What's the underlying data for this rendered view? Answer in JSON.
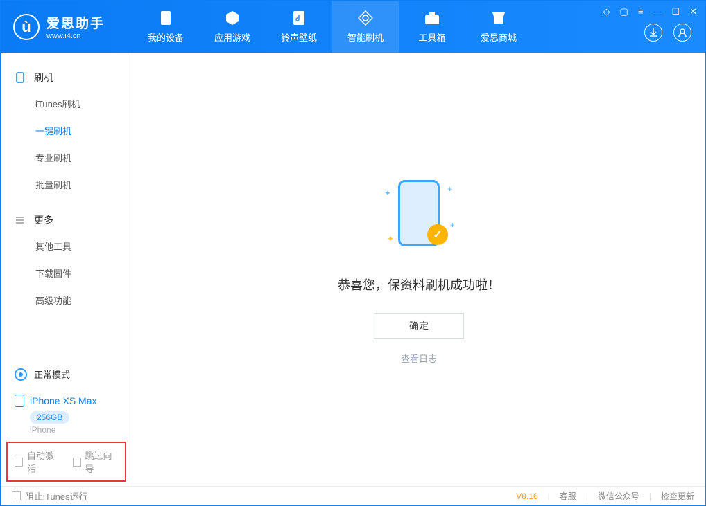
{
  "app": {
    "title": "爱思助手",
    "url": "www.i4.cn"
  },
  "nav": {
    "items": [
      {
        "label": "我的设备"
      },
      {
        "label": "应用游戏"
      },
      {
        "label": "铃声壁纸"
      },
      {
        "label": "智能刷机"
      },
      {
        "label": "工具箱"
      },
      {
        "label": "爱思商城"
      }
    ]
  },
  "sidebar": {
    "group1": {
      "title": "刷机"
    },
    "items1": [
      {
        "label": "iTunes刷机"
      },
      {
        "label": "一键刷机"
      },
      {
        "label": "专业刷机"
      },
      {
        "label": "批量刷机"
      }
    ],
    "group2": {
      "title": "更多"
    },
    "items2": [
      {
        "label": "其他工具"
      },
      {
        "label": "下载固件"
      },
      {
        "label": "高级功能"
      }
    ]
  },
  "device": {
    "mode": "正常模式",
    "name": "iPhone XS Max",
    "storage": "256GB",
    "sub": "iPhone"
  },
  "options": {
    "auto_activate": "自动激活",
    "skip_guide": "跳过向导"
  },
  "main": {
    "message": "恭喜您，保资料刷机成功啦！",
    "ok": "确定",
    "view_log": "查看日志"
  },
  "footer": {
    "block_itunes": "阻止iTunes运行",
    "version": "V8.16",
    "links": [
      "客服",
      "微信公众号",
      "检查更新"
    ]
  }
}
